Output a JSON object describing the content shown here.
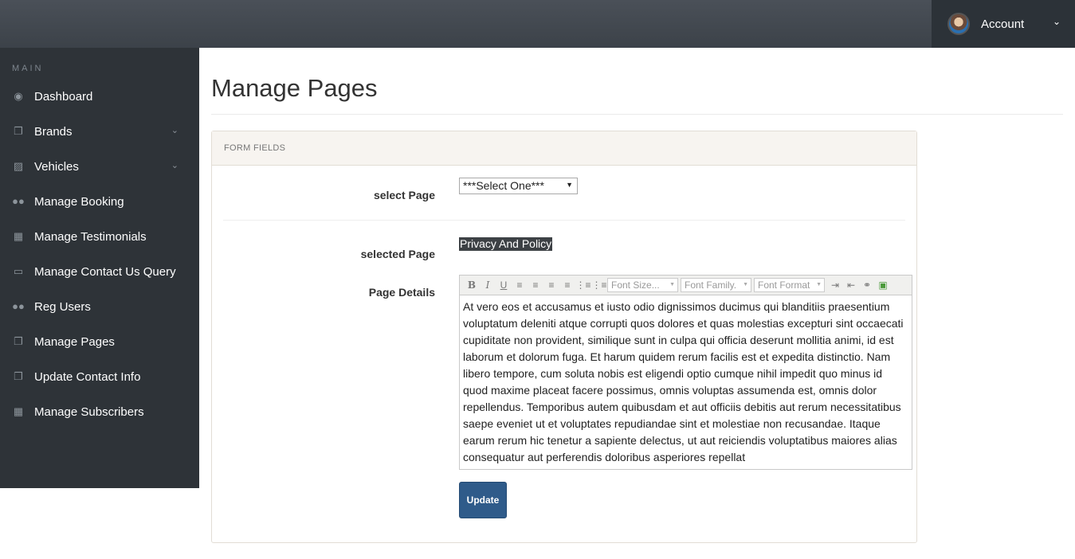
{
  "header": {
    "account_label": "Account"
  },
  "sidebar": {
    "section_label": "MAIN",
    "items": [
      {
        "label": "Dashboard",
        "icon": "dashboard-icon",
        "has_submenu": false
      },
      {
        "label": "Brands",
        "icon": "files-icon",
        "has_submenu": true
      },
      {
        "label": "Vehicles",
        "icon": "sitemap-icon",
        "has_submenu": true
      },
      {
        "label": "Manage Booking",
        "icon": "users-icon",
        "has_submenu": false
      },
      {
        "label": "Manage Testimonials",
        "icon": "table-icon",
        "has_submenu": false
      },
      {
        "label": "Manage Contact Us Query",
        "icon": "desktop-icon",
        "has_submenu": false
      },
      {
        "label": "Reg Users",
        "icon": "users-icon",
        "has_submenu": false
      },
      {
        "label": "Manage Pages",
        "icon": "files-icon",
        "has_submenu": false
      },
      {
        "label": "Update Contact Info",
        "icon": "files-icon",
        "has_submenu": false
      },
      {
        "label": "Manage Subscribers",
        "icon": "table-icon",
        "has_submenu": false
      }
    ]
  },
  "main": {
    "title": "Manage Pages",
    "panel_heading": "FORM FIELDS",
    "select_page_label": "select Page",
    "select_page_value": "***Select One***",
    "selected_page_label": "selected Page",
    "selected_page_value": "Privacy And Policy",
    "page_details_label": "Page Details",
    "editor": {
      "font_size_placeholder": "Font Size...",
      "font_family_placeholder": "Font Family.",
      "font_format_placeholder": "Font Format",
      "content": "At vero eos et accusamus et iusto odio dignissimos ducimus qui blanditiis praesentium voluptatum deleniti atque corrupti quos dolores et quas molestias excepturi sint occaecati cupiditate non provident, similique sunt in culpa qui officia deserunt mollitia animi, id est laborum et dolorum fuga. Et harum quidem rerum facilis est et expedita distinctio. Nam libero tempore, cum soluta nobis est eligendi optio cumque nihil impedit quo minus id quod maxime placeat facere possimus, omnis voluptas assumenda est, omnis dolor repellendus. Temporibus autem quibusdam et aut officiis debitis aut rerum necessitatibus saepe eveniet ut et voluptates repudiandae sint et molestiae non recusandae. Itaque earum rerum hic tenetur a sapiente delectus, ut aut reiciendis voluptatibus maiores alias consequatur aut perferendis doloribus asperiores repellat"
    },
    "update_button": "Update"
  },
  "colors": {
    "sidebar_bg": "#2e3338",
    "topbar_bg": "#4a5058",
    "button_bg": "#2f5b8a"
  }
}
